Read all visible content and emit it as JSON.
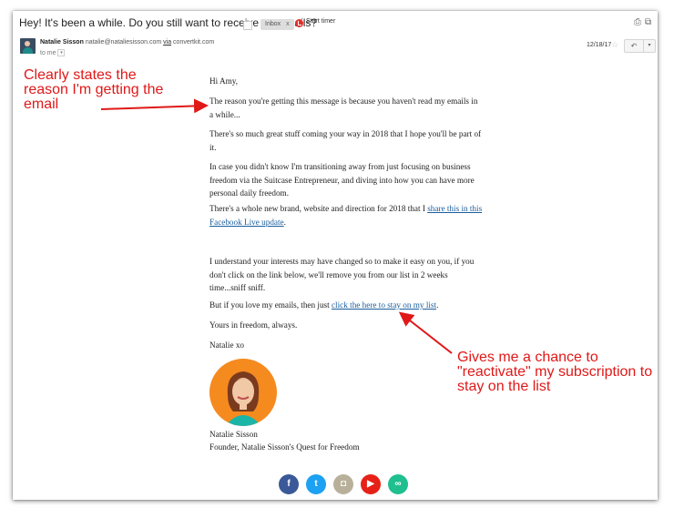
{
  "subject": {
    "title": "Hey! It's been a while. Do you still want to receive my emails?",
    "label": "Inbox",
    "label_close": "x",
    "timer": "Start timer"
  },
  "sender": {
    "name": "Natalie Sisson",
    "email": "natalie@nataliesisson.com",
    "via": "via",
    "via_domain": "convertkit.com",
    "to": "to me",
    "date": "12/18/17"
  },
  "email": {
    "greeting": "Hi Amy,",
    "p1": "The reason you're getting this message is because you haven't read my emails in a while...",
    "p2": "There's so much great stuff coming your way in 2018 that I hope you'll be part of it.",
    "p3": "In case you didn't know I'm transitioning away from just focusing on business freedom via the Suitcase Entrepreneur, and diving into how you can have more personal daily freedom.",
    "p4_prefix": "There's a whole new brand, website and direction for 2018 that I ",
    "p4_link": "share this in this Facebook Live update",
    "p4_suffix": ".",
    "p5": "I understand your interests may have changed so to make it easy on you, if you don't click on the link below, we'll remove you from our list in 2 weeks time...sniff sniff.",
    "p6_prefix": "But if you love my emails, then just ",
    "p6_link": "click the here to stay on my list",
    "p6_suffix": ".",
    "closing": "Yours in freedom, always.",
    "signoff": "Natalie xo",
    "sig_name": "Natalie Sisson",
    "sig_title": "Founder, Natalie Sisson's Quest for Freedom"
  },
  "annotations": {
    "left": "Clearly states the reason I'm getting the email",
    "right": "Gives me a chance to \"reactivate\" my subscription to stay on the list",
    "color": "#e01818"
  },
  "social_icons": [
    {
      "name": "facebook-icon",
      "glyph": "f",
      "color": "#3b5998"
    },
    {
      "name": "twitter-icon",
      "glyph": "t",
      "color": "#1da1f2"
    },
    {
      "name": "instagram-icon",
      "glyph": "◘",
      "color": "#b8b09a"
    },
    {
      "name": "youtube-icon",
      "glyph": "▶",
      "color": "#e62117"
    },
    {
      "name": "link-icon",
      "glyph": "∞",
      "color": "#1fbf8f"
    }
  ]
}
